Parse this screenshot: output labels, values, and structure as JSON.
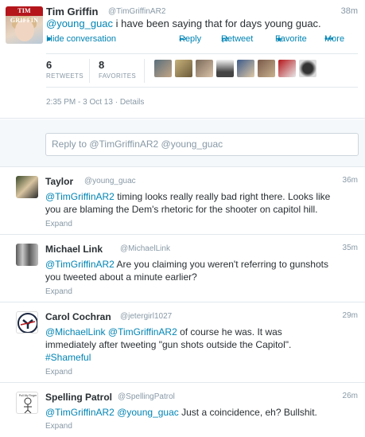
{
  "main_tweet": {
    "avatar_logo": "TIM GRIFFIN",
    "fullname": "Tim Griffin",
    "screenname": "@TimGriffinAR2",
    "time": "38m",
    "text_mention": "@young_guac",
    "text_body": " i have been saying that for days young guac.",
    "actions": {
      "hide_label": "Hide conversation",
      "reply_label": "Reply",
      "retweet_label": "Retweet",
      "favorite_label": "Favorite",
      "more_label": "More"
    },
    "stats": {
      "retweets_count": "6",
      "retweets_label": "RETWEETS",
      "favorites_count": "8",
      "favorites_label": "FAVORITES"
    },
    "timestamp": "2:35 PM - 3 Oct 13",
    "details_label": "Details"
  },
  "reply_box": {
    "placeholder": "Reply to @TimGriffinAR2 @young_guac"
  },
  "replies": [
    {
      "fullname": "Taylor",
      "screenname": "@young_guac",
      "time": "36m",
      "line1_mention": "@TimGriffinAR2",
      "line1_text": " timing looks really really bad right there. Looks like",
      "line2_text": "you are blaming the Dem's rhetoric for the shooter on capitol hill.",
      "expand_label": "Expand"
    },
    {
      "fullname": "Michael Link",
      "screenname": "@MichaelLink",
      "time": "35m",
      "line1_mention": "@TimGriffinAR2",
      "line1_text": " Are you claiming you weren't referring to gunshots",
      "line2_text": "you tweeted about a minute earlier?",
      "expand_label": "Expand"
    },
    {
      "fullname": "Carol Cochran",
      "screenname": "@jetergirl1027",
      "time": "29m",
      "line1_mention1": "@MichaelLink",
      "line1_mention2": "@TimGriffinAR2",
      "line1_text": " of course he was. It was",
      "line2_text": "immediately after tweeting \"gun shots outside the Capitol\".",
      "line3_hashtag": "#Shameful",
      "expand_label": "Expand"
    },
    {
      "fullname": "Spelling Patrol",
      "screenname": "@SpellingPatrol",
      "time": "26m",
      "line1_mention1": "@TimGriffinAR2",
      "line1_mention2": "@young_guac",
      "line1_text": " Just a coincidence, eh? Bullshit.",
      "avatar_caption": "Pull My Finger",
      "expand_label": "Expand"
    }
  ],
  "colors": {
    "link": "#0084b4",
    "muted": "#8899a6",
    "text": "#292f33",
    "divider": "#e1e8ed"
  }
}
